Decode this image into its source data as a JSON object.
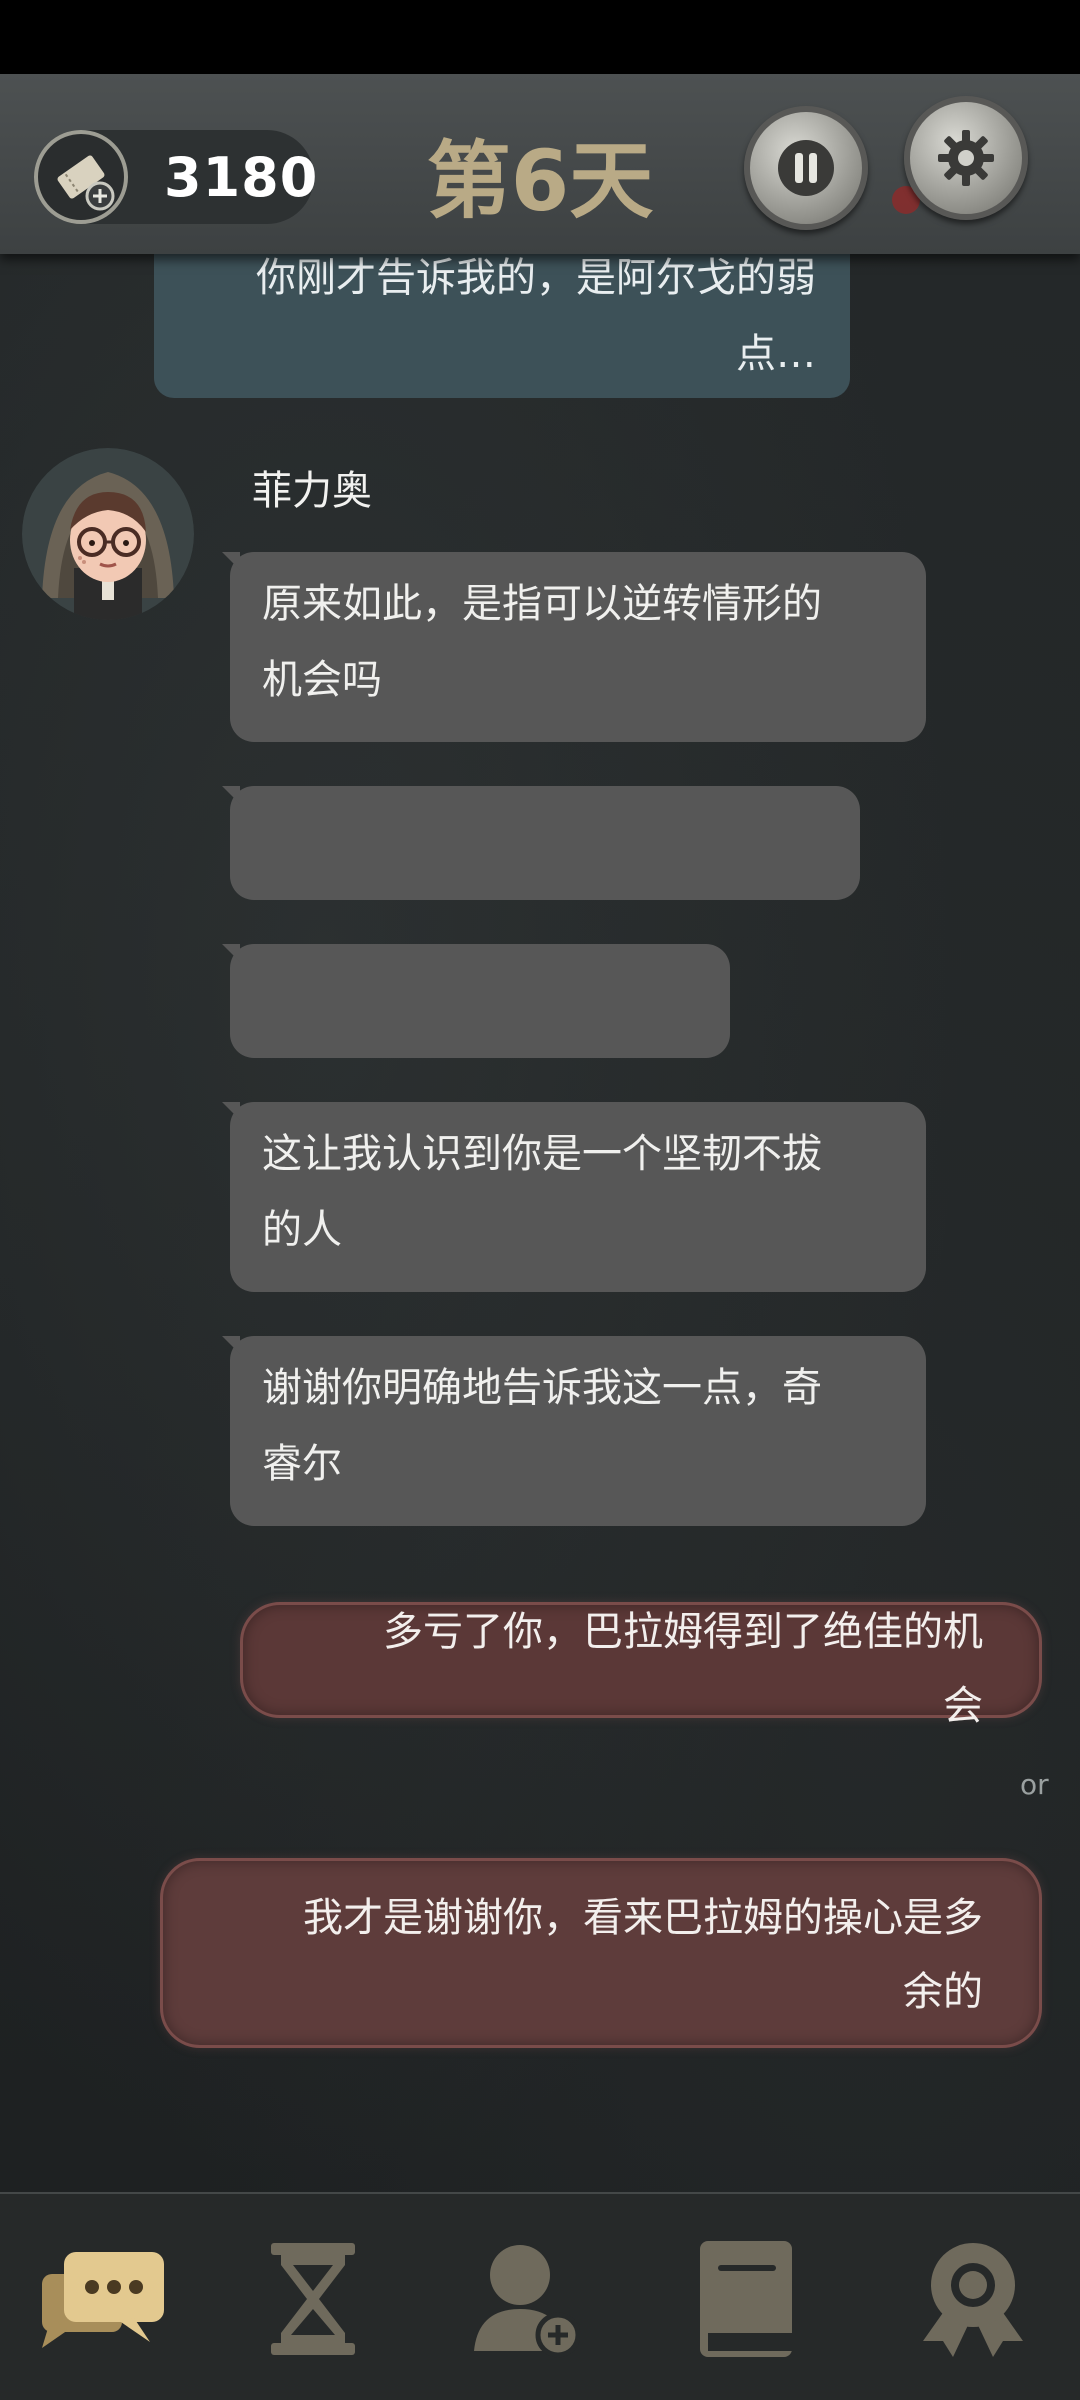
{
  "header": {
    "ticket_count": "3180",
    "day_title": "第6天"
  },
  "icons": {
    "ticket": "ticket-add-icon",
    "pause": "pause-icon",
    "settings": "gear-icon"
  },
  "colors": {
    "day_title": "#b9aa86",
    "npc_bubble": "#575757",
    "player_bubble": "#3d5158",
    "choice_bubble": "#5b3837"
  },
  "previous_player_message": {
    "line1": "你刚才告诉我的，是阿尔戈的弱",
    "line2": "点…"
  },
  "npc": {
    "name": "菲力奥",
    "messages": [
      {
        "line1": "原来如此，是指可以逆转情形的",
        "line2": "机会吗"
      },
      {
        "line1": "",
        "line2": ""
      },
      {
        "line1": "",
        "line2": ""
      },
      {
        "line1": "这让我认识到你是一个坚韧不拔",
        "line2": "的人"
      },
      {
        "line1": "谢谢你明确地告诉我这一点，奇",
        "line2": "睿尔"
      }
    ]
  },
  "choices": [
    {
      "line1": "多亏了你，巴拉姆得到了绝佳的机",
      "line2": "会"
    },
    {
      "line1": "我才是谢谢你，看来巴拉姆的操心是多",
      "line2": "余的"
    }
  ],
  "or_label": "or",
  "bottom_nav": [
    {
      "name": "chat",
      "icon": "chat-bubbles-icon",
      "active": true
    },
    {
      "name": "time",
      "icon": "hourglass-icon",
      "active": false
    },
    {
      "name": "characters",
      "icon": "add-person-icon",
      "active": false
    },
    {
      "name": "book",
      "icon": "book-icon",
      "active": false
    },
    {
      "name": "achievements",
      "icon": "medal-icon",
      "active": false
    }
  ]
}
